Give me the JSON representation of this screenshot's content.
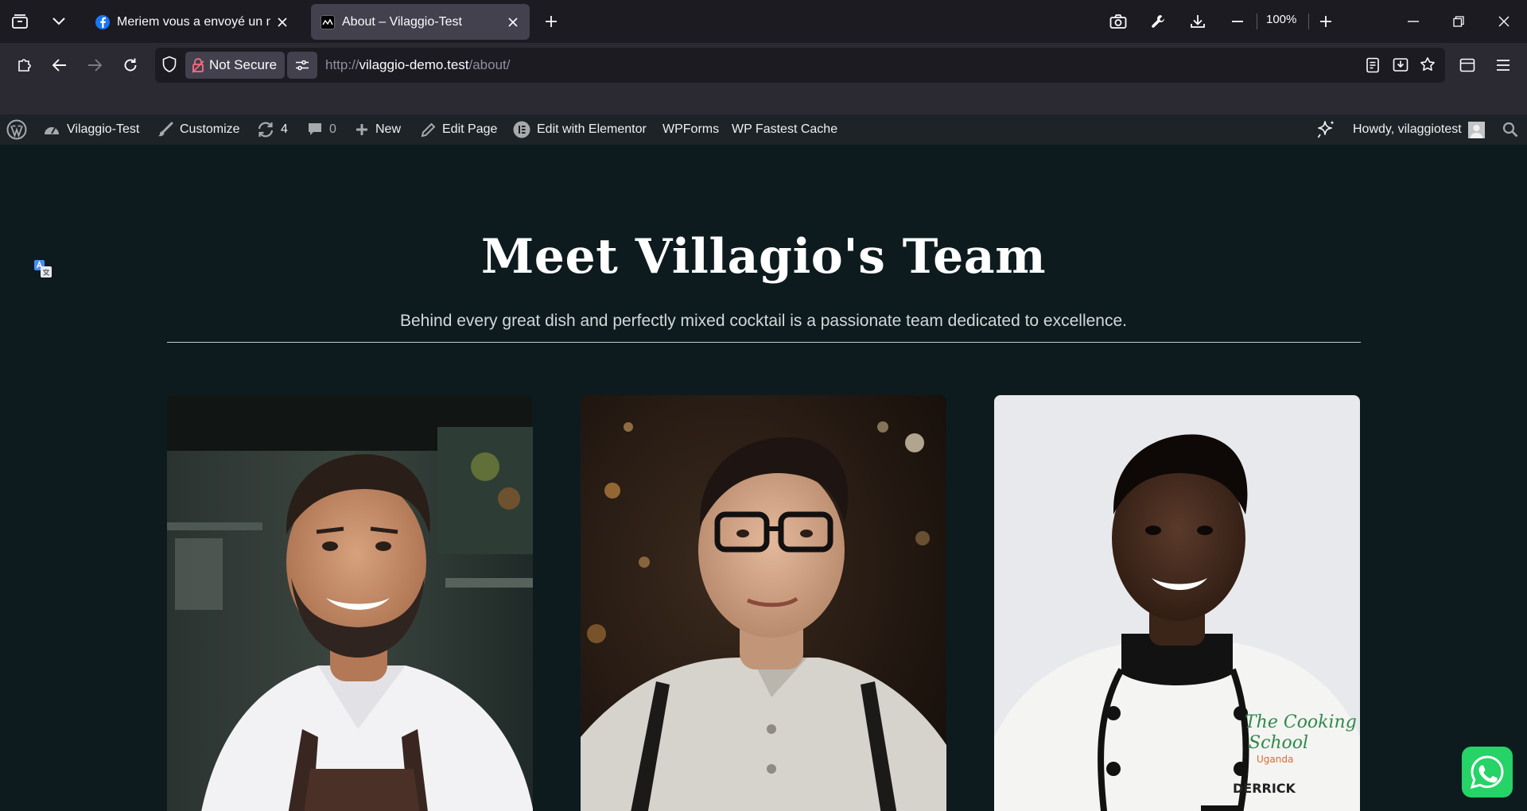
{
  "browser": {
    "tabs": [
      {
        "title": "Meriem vous a envoyé un mess",
        "active": false,
        "favicon": "facebook-icon"
      },
      {
        "title": "About – Vilaggio-Test",
        "active": true,
        "favicon": "site-icon"
      }
    ],
    "zoom": "100%",
    "security_label": "Not Secure",
    "url": {
      "scheme": "http://",
      "host": "vilaggio-demo.test",
      "path": "/about/"
    }
  },
  "wp_admin_bar": {
    "site_name": "Vilaggio-Test",
    "customize": "Customize",
    "updates_count": "4",
    "comments_count": "0",
    "new": "New",
    "edit_page": "Edit Page",
    "edit_elementor": "Edit with Elementor",
    "wpforms": "WPForms",
    "fastest_cache": "WP Fastest Cache",
    "howdy": "Howdy, vilaggiotest"
  },
  "page": {
    "title": "Meet Villagio's Team",
    "subtitle": "Behind every great dish and perfectly mixed cocktail is a passionate team dedicated to excellence.",
    "team_photos": [
      {
        "icon": "team-member-photo"
      },
      {
        "icon": "team-member-photo"
      },
      {
        "icon": "team-member-photo"
      }
    ],
    "chef_jacket_logo": "The Cooking School Uganda",
    "chef_name_tag": "DERRICK"
  },
  "colors": {
    "page_bg": "#0d1b1f",
    "wp_bar_bg": "#1d2327",
    "whatsapp_green": "#25d366"
  }
}
